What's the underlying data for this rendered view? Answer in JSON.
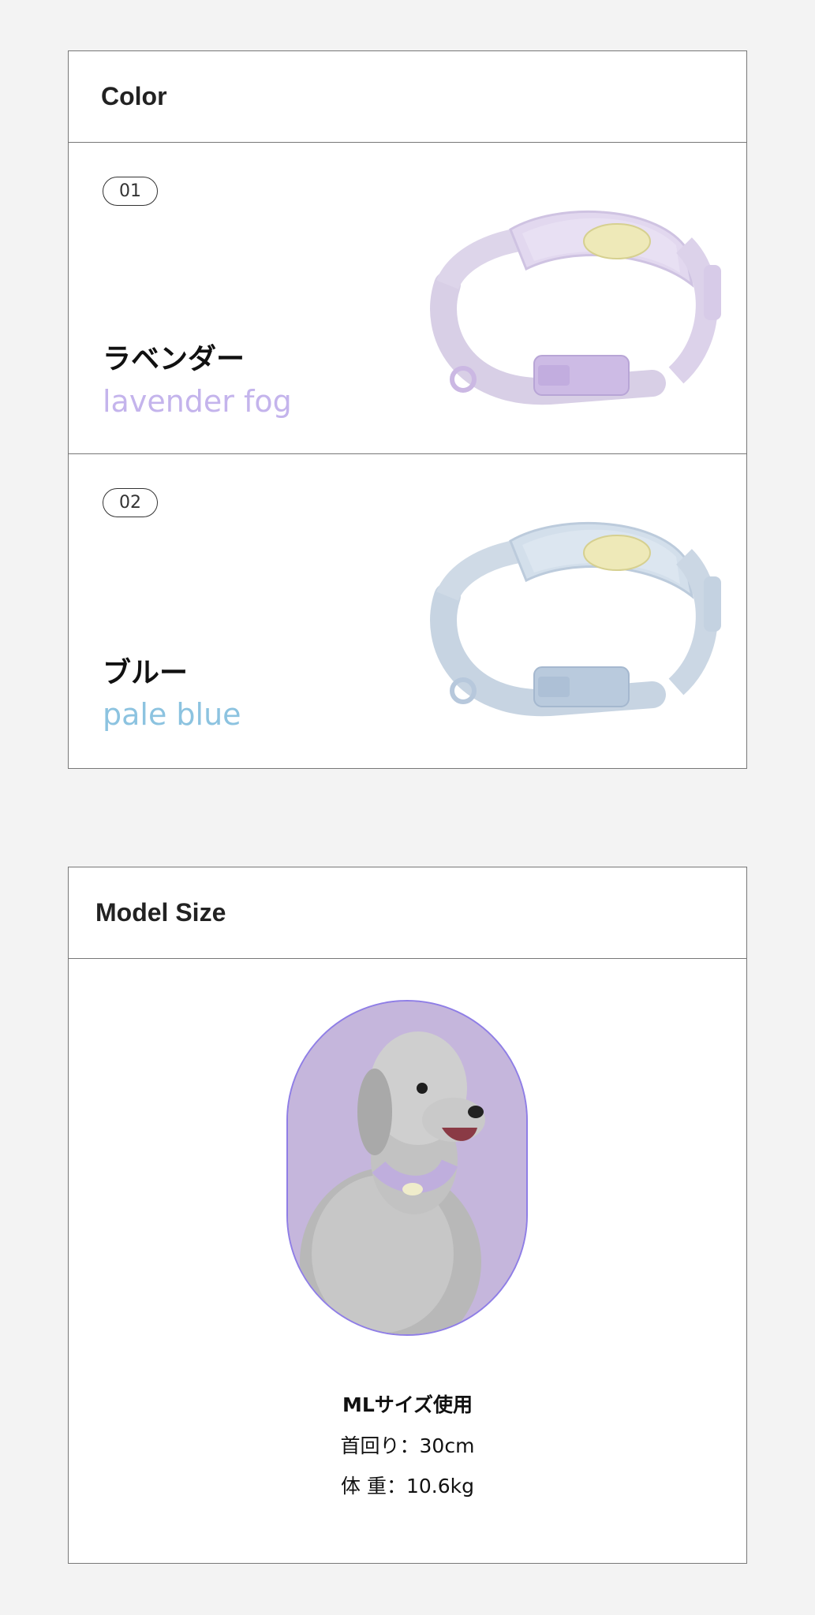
{
  "color_section": {
    "title": "Color",
    "items": [
      {
        "number": "01",
        "name_jp": "ラベンダー",
        "name_en": "lavender fog",
        "name_en_color": "#c4b4ec",
        "collar_icon": "collar-lavender"
      },
      {
        "number": "02",
        "name_jp": "ブルー",
        "name_en": "pale blue",
        "name_en_color": "#8cc3e0",
        "collar_icon": "collar-blue"
      }
    ]
  },
  "model_section": {
    "title": "Model Size",
    "photo": "dog-photo",
    "size_used": "MLサイズ使用",
    "neck": "首回り：30cm",
    "weight": "体 重：10.6kg"
  }
}
